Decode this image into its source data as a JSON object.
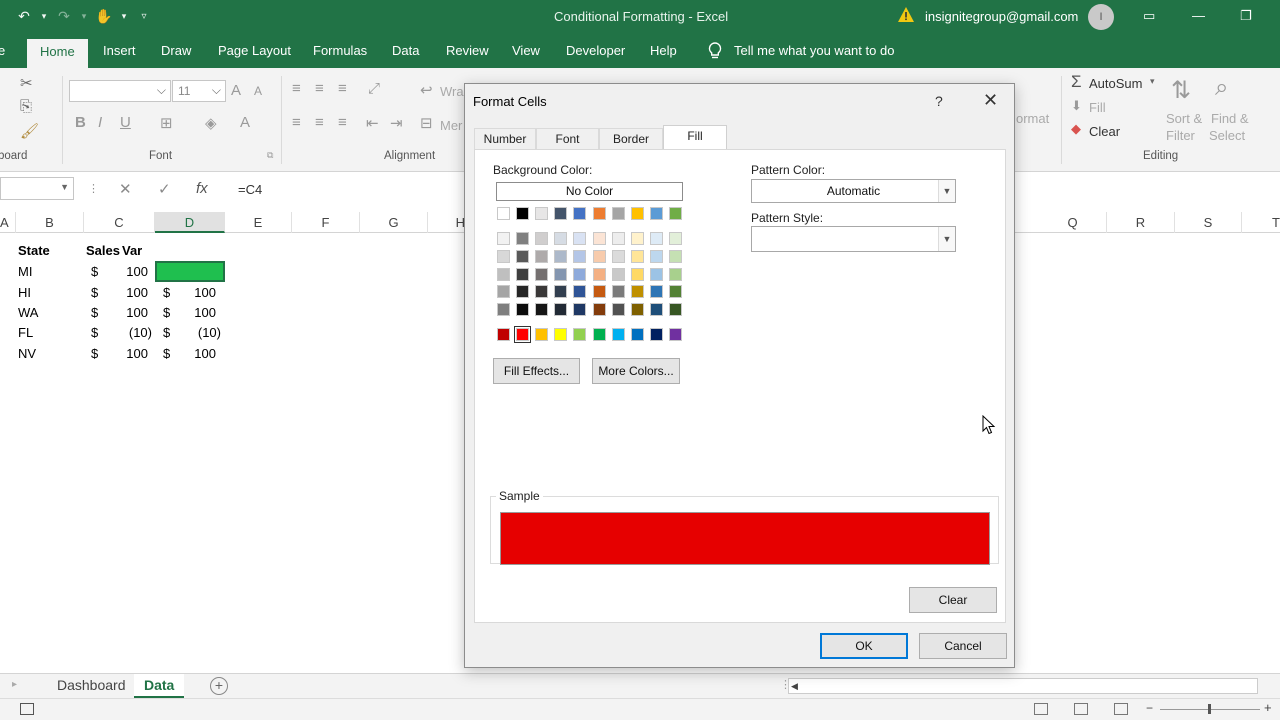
{
  "window": {
    "title": "Conditional Formatting  -  Excel",
    "account": "insignitegroup@gmail.com",
    "avatar_initial": "I",
    "minimize_icon": "—",
    "restore_icon": "❐",
    "ribbon_display_icon": "▭"
  },
  "ribbon_tabs": [
    "e",
    "Home",
    "Insert",
    "Draw",
    "Page Layout",
    "Formulas",
    "Data",
    "Review",
    "View",
    "Developer",
    "Help"
  ],
  "tell_me": "Tell me what you want to do",
  "ribbon": {
    "clipboard_group": "board",
    "font_group": "Font",
    "alignment_group": "Alignment",
    "editing_group": "Editing",
    "font_size": "11",
    "bold": "B",
    "italic": "I",
    "underline": "U",
    "wrap": "Wra",
    "merge": "Mer",
    "format": "ormat",
    "autosum": "AutoSum",
    "fill": "Fill",
    "clear": "Clear",
    "sort_filter_1": "Sort &",
    "sort_filter_2": "Filter",
    "find_select_1": "Find &",
    "find_select_2": "Select"
  },
  "formula_bar": {
    "formula": "=C4"
  },
  "columns": [
    "A",
    "B",
    "C",
    "D",
    "E",
    "F",
    "G",
    "H",
    "Q",
    "R",
    "S",
    "T"
  ],
  "sheet": {
    "headers": {
      "state": "State",
      "sales": "Sales",
      "var": "Var"
    },
    "rows": [
      {
        "state": "MI",
        "sales_cur": "$",
        "sales": "100",
        "var_cur": "",
        "var": ""
      },
      {
        "state": "HI",
        "sales_cur": "$",
        "sales": "100",
        "var_cur": "$",
        "var": "100"
      },
      {
        "state": "WA",
        "sales_cur": "$",
        "sales": "100",
        "var_cur": "$",
        "var": "100"
      },
      {
        "state": "FL",
        "sales_cur": "$",
        "sales": "(10)",
        "var_cur": "$",
        "var": "(10)"
      },
      {
        "state": "NV",
        "sales_cur": "$",
        "sales": "100",
        "var_cur": "$",
        "var": "100"
      }
    ],
    "selected_fill": "#1fbf4f"
  },
  "sheet_tabs": [
    "Dashboard",
    "Data"
  ],
  "add_sheet": "+",
  "dialog": {
    "title": "Format Cells",
    "help": "?",
    "tabs": [
      "Number",
      "Font",
      "Border",
      "Fill"
    ],
    "active_tab": "Fill",
    "background_color_label": "Background Color:",
    "no_color": "No Color",
    "pattern_color_label": "Pattern Color:",
    "pattern_color_value": "Automatic",
    "pattern_style_label": "Pattern Style:",
    "pattern_style_value": "",
    "fill_effects": "Fill Effects...",
    "more_colors": "More Colors...",
    "sample_label": "Sample",
    "sample_color": "#e60000",
    "clear": "Clear",
    "ok": "OK",
    "cancel": "Cancel",
    "theme_colors_top": [
      "#ffffff",
      "#000000",
      "#e7e6e6",
      "#44546a",
      "#4472c4",
      "#ed7d31",
      "#a5a5a5",
      "#ffc000",
      "#5b9bd5",
      "#70ad47"
    ],
    "theme_shades": [
      [
        "#f2f2f2",
        "#808080",
        "#d0cece",
        "#d6dce4",
        "#d9e2f3",
        "#fbe4d5",
        "#ededed",
        "#fff2cc",
        "#deebf6",
        "#e2efd9"
      ],
      [
        "#d8d8d8",
        "#595959",
        "#aeaaaa",
        "#adb9ca",
        "#b4c6e7",
        "#f7cbac",
        "#dbdbdb",
        "#ffe598",
        "#bdd7ee",
        "#c5e0b3"
      ],
      [
        "#bfbfbf",
        "#3f3f3f",
        "#757070",
        "#8496b0",
        "#8eaadb",
        "#f4b083",
        "#c9c9c9",
        "#ffd965",
        "#9cc3e5",
        "#a8d08d"
      ],
      [
        "#a5a5a5",
        "#262626",
        "#3a3838",
        "#323f4f",
        "#2f5496",
        "#c55a11",
        "#7b7b7b",
        "#bf8f00",
        "#2e75b5",
        "#538135"
      ],
      [
        "#7f7f7f",
        "#0c0c0c",
        "#161616",
        "#222a35",
        "#1f3864",
        "#833c0b",
        "#525252",
        "#7f6000",
        "#1e4e79",
        "#375623"
      ]
    ],
    "standard_colors": [
      "#c00000",
      "#ff0000",
      "#ffc000",
      "#ffff00",
      "#92d050",
      "#00b050",
      "#00b0f0",
      "#0070c0",
      "#002060",
      "#7030a0"
    ],
    "selected_standard_index": 1
  }
}
